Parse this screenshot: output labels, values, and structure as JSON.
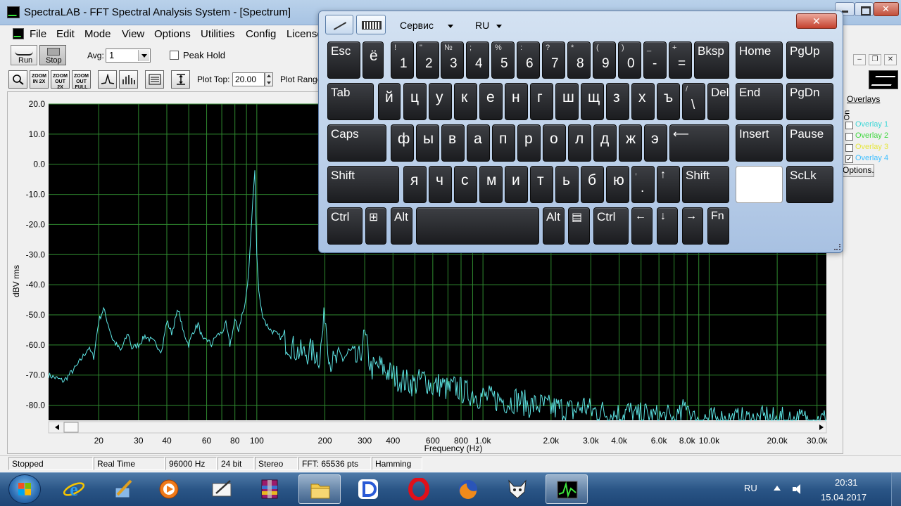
{
  "window": {
    "title": "SpectraLAB - FFT Spectral Analysis System - [Spectrum]"
  },
  "menu": [
    "File",
    "Edit",
    "Mode",
    "View",
    "Options",
    "Utilities",
    "Config",
    "License"
  ],
  "toolbar": {
    "run_label": "Run",
    "stop_label": "Stop",
    "avg_label": "Avg:",
    "avg_value": "1",
    "peak_hold_label": "Peak Hold",
    "zoom_buttons": [
      "",
      "ZOOM IN 2X",
      "ZOOM OUT 2X",
      "ZOOM OUT FULL",
      "",
      "",
      "",
      ""
    ],
    "plot_top_label": "Plot Top:",
    "plot_top_value": "20.00",
    "plot_range_label": "Plot Range"
  },
  "overlays": {
    "title": "Overlays",
    "on_label": "On",
    "items": [
      {
        "label": "Overlay 1",
        "checked": false,
        "color": "#3fd7d7"
      },
      {
        "label": "Overlay 2",
        "checked": false,
        "color": "#3fd73f"
      },
      {
        "label": "Overlay 3",
        "checked": false,
        "color": "#e6e63f"
      },
      {
        "label": "Overlay 4",
        "checked": true,
        "color": "#3fbfff"
      }
    ],
    "options_label": "Options..."
  },
  "status": {
    "state": "Stopped",
    "mode": "Real Time",
    "sample_rate": "96000 Hz",
    "bit_depth": "24 bit",
    "channels": "Stereo",
    "fft": "FFT: 65536 pts",
    "window": "Hamming"
  },
  "chart_data": {
    "type": "line",
    "xlabel": "Frequency (Hz)",
    "ylabel": "dBV rms",
    "x_scale": "log",
    "xlim": [
      12,
      33000
    ],
    "ylim": [
      -85,
      20
    ],
    "yticks": [
      "20.0",
      "10.0",
      "0.0",
      "-10.0",
      "-20.0",
      "-30.0",
      "-40.0",
      "-50.0",
      "-60.0",
      "-70.0",
      "-80.0"
    ],
    "xticks": [
      {
        "value": 20,
        "label": "20"
      },
      {
        "value": 30,
        "label": "30"
      },
      {
        "value": 40,
        "label": "40"
      },
      {
        "value": 60,
        "label": "60"
      },
      {
        "value": 80,
        "label": "80"
      },
      {
        "value": 100,
        "label": "100"
      },
      {
        "value": 200,
        "label": "200"
      },
      {
        "value": 300,
        "label": "300"
      },
      {
        "value": 400,
        "label": "400"
      },
      {
        "value": 600,
        "label": "600"
      },
      {
        "value": 800,
        "label": "800"
      },
      {
        "value": 1000,
        "label": "1.0k"
      },
      {
        "value": 2000,
        "label": "2.0k"
      },
      {
        "value": 3000,
        "label": "3.0k"
      },
      {
        "value": 4000,
        "label": "4.0k"
      },
      {
        "value": 6000,
        "label": "6.0k"
      },
      {
        "value": 8000,
        "label": "8.0k"
      },
      {
        "value": 10000,
        "label": "10.0k"
      },
      {
        "value": 20000,
        "label": "20.0k"
      },
      {
        "value": 30000,
        "label": "30.0k"
      }
    ],
    "grid": true,
    "background": "#000000",
    "grid_color": "#2f8a2f",
    "line_color": "#5ee6e6",
    "series": [
      {
        "x": [
          12,
          14,
          16,
          18,
          19,
          20,
          21,
          22,
          23,
          25,
          27,
          28,
          30,
          32,
          35,
          38,
          40,
          42,
          45,
          47,
          50,
          52,
          55,
          58,
          60,
          63,
          66,
          70,
          73,
          76,
          80,
          83,
          86,
          88,
          90,
          92,
          94,
          96,
          98,
          100,
          102,
          105,
          110,
          115,
          120,
          130,
          140,
          150,
          160,
          175,
          190,
          200,
          210,
          220,
          240,
          260,
          280,
          300,
          320,
          350,
          380,
          400,
          420,
          450,
          500,
          550,
          600,
          650,
          700,
          760,
          800,
          850,
          900,
          950,
          1000,
          1100,
          1200,
          1300,
          1400,
          1500,
          1600,
          1800,
          2000,
          2200,
          2500,
          2800,
          3000,
          3300,
          3600,
          4000,
          4400,
          4800,
          5200,
          5600,
          6000,
          6500,
          7000,
          7500,
          8000,
          8300,
          8600,
          9000,
          9500,
          10000,
          11000,
          12000,
          13000,
          14000,
          15000,
          16000,
          17000,
          18000,
          19000,
          20000,
          22000,
          24000,
          26000,
          28000,
          30000,
          33000
        ],
        "y": [
          -70,
          -72,
          -67,
          -61,
          -64,
          -52,
          -48,
          -53,
          -58,
          -62,
          -56,
          -61,
          -60,
          -57,
          -59,
          -62,
          -52,
          -56,
          -48,
          -55,
          -60,
          -56,
          -53,
          -59,
          -58,
          -60,
          -57,
          -56,
          -53,
          -60,
          -52,
          -55,
          -50,
          -48,
          -43,
          -36,
          -24,
          -12,
          -2,
          -30,
          -42,
          -49,
          -53,
          -55,
          -56,
          -58,
          -60,
          -62,
          -63,
          -62,
          -64,
          -49,
          -65,
          -66,
          -64,
          -63,
          -66,
          -57,
          -68,
          -67,
          -69,
          -70,
          -71,
          -72,
          -73,
          -71,
          -74,
          -73,
          -75,
          -74,
          -75,
          -76,
          -76,
          -77,
          -77,
          -78,
          -78,
          -79,
          -78,
          -79,
          -80,
          -80,
          -81,
          -81,
          -82,
          -80,
          -82,
          -82,
          -83,
          -83,
          -82,
          -84,
          -83,
          -84,
          -84,
          -84,
          -85,
          -84,
          -78,
          -84,
          -85,
          -85,
          -84,
          -85,
          -85,
          -85,
          -85,
          -85,
          -85,
          -85,
          -85,
          -84,
          -85,
          -85,
          -85,
          -85,
          -85,
          -85,
          -85,
          -85
        ]
      }
    ]
  },
  "keyboard": {
    "menu_service": "Сервис",
    "menu_lang": "RU",
    "rows": [
      [
        {
          "l": "Esc"
        },
        {
          "m": "ё"
        },
        {
          "s": "!",
          "m": "1"
        },
        {
          "s": "\"",
          "m": "2"
        },
        {
          "s": "№",
          "m": "3"
        },
        {
          "s": ";",
          "m": "4"
        },
        {
          "s": "%",
          "m": "5"
        },
        {
          "s": ":",
          "m": "6"
        },
        {
          "s": "?",
          "m": "7"
        },
        {
          "s": "*",
          "m": "8"
        },
        {
          "s": "(",
          "m": "9"
        },
        {
          "s": ")",
          "m": "0"
        },
        {
          "s": "_",
          "m": "-"
        },
        {
          "s": "+",
          "m": "="
        },
        {
          "l": "Bksp"
        },
        {
          "l": "Home"
        },
        {
          "l": "PgUp"
        }
      ],
      [
        {
          "l": "Tab"
        },
        {
          "m": "й"
        },
        {
          "m": "ц"
        },
        {
          "m": "у"
        },
        {
          "m": "к"
        },
        {
          "m": "е"
        },
        {
          "m": "н"
        },
        {
          "m": "г"
        },
        {
          "m": "ш"
        },
        {
          "m": "щ"
        },
        {
          "m": "з"
        },
        {
          "m": "х"
        },
        {
          "m": "ъ"
        },
        {
          "s": "/",
          "m": "\\"
        },
        {
          "l": "Del"
        },
        {
          "l": "End"
        },
        {
          "l": "PgDn"
        }
      ],
      [
        {
          "l": "Caps"
        },
        {
          "m": "ф"
        },
        {
          "m": "ы"
        },
        {
          "m": "в"
        },
        {
          "m": "а"
        },
        {
          "m": "п"
        },
        {
          "m": "р"
        },
        {
          "m": "о"
        },
        {
          "m": "л"
        },
        {
          "m": "д"
        },
        {
          "m": "ж"
        },
        {
          "m": "э"
        },
        {
          "l": "⟵"
        },
        {
          "l": "Insert"
        },
        {
          "l": "Pause"
        }
      ],
      [
        {
          "l": "Shift"
        },
        {
          "m": "я"
        },
        {
          "m": "ч"
        },
        {
          "m": "с"
        },
        {
          "m": "м"
        },
        {
          "m": "и"
        },
        {
          "m": "т"
        },
        {
          "m": "ь"
        },
        {
          "m": "б"
        },
        {
          "m": "ю"
        },
        {
          "s": ",",
          "m": "."
        },
        {
          "l": "↑"
        },
        {
          "l": "Shift"
        },
        {
          "l": ""
        },
        {
          "l": "ScLk"
        }
      ],
      [
        {
          "l": "Ctrl"
        },
        {
          "l": "⊞"
        },
        {
          "l": "Alt"
        },
        {
          "l": ""
        },
        {
          "l": "Alt"
        },
        {
          "l": "▤"
        },
        {
          "l": "Ctrl"
        },
        {
          "l": "←"
        },
        {
          "l": "↓"
        },
        {
          "l": "→"
        },
        {
          "l": "Fn"
        }
      ]
    ]
  },
  "taskbar": {
    "apps": [
      "internet-explorer",
      "paint-tool",
      "media-player",
      "tablet-input",
      "winrar",
      "file-explorer",
      "app-d",
      "opera",
      "firefox",
      "foobar",
      "spectralab"
    ],
    "tray_lang": "RU",
    "time": "20:31",
    "date": "15.04.2017"
  }
}
